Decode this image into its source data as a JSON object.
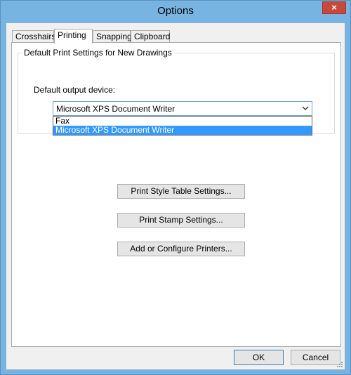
{
  "window": {
    "title": "Options",
    "close_glyph": "×"
  },
  "tabs": [
    {
      "label": "Crosshairs"
    },
    {
      "label": "Printing"
    },
    {
      "label": "Snapping"
    },
    {
      "label": "Clipboard"
    }
  ],
  "group": {
    "label": "Default Print Settings for New Drawings",
    "device_label": "Default output device:",
    "selected": "Microsoft XPS Document Writer",
    "options": [
      "Fax",
      "Microsoft XPS Document Writer"
    ]
  },
  "buttons": {
    "print_style": "Print Style Table Settings...",
    "print_stamp": "Print Stamp Settings...",
    "printers": "Add or Configure Printers..."
  },
  "footer": {
    "ok": "OK",
    "cancel": "Cancel"
  },
  "colors": {
    "selection": "#3399ff",
    "frame": "#78b4e2",
    "close": "#c7493b"
  }
}
